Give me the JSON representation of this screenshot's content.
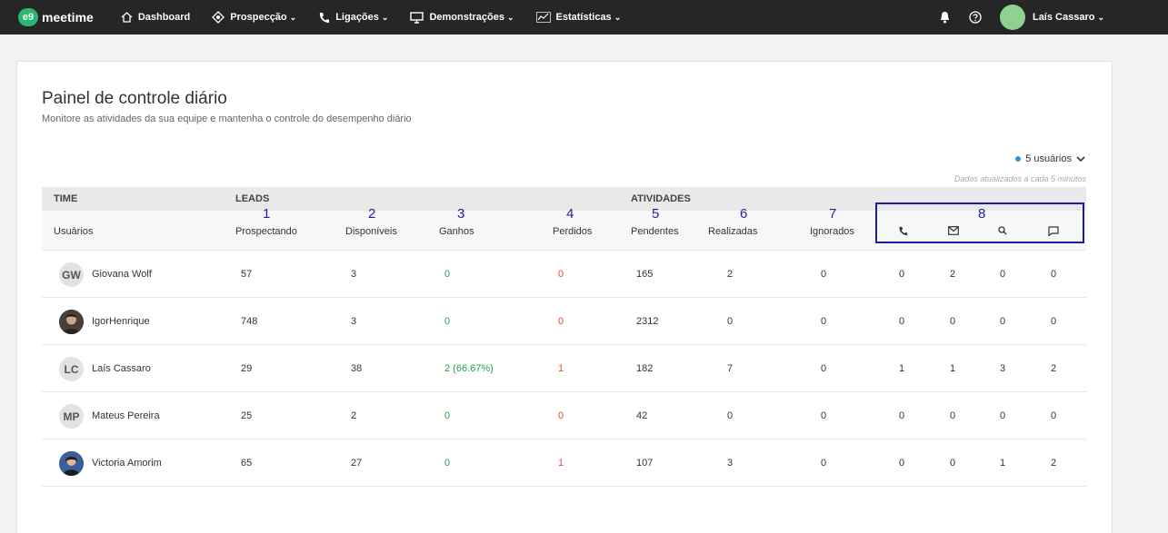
{
  "nav": {
    "logo_badge": "e9",
    "logo_text": "meetime",
    "items": [
      {
        "label": "Dashboard",
        "icon": "home-icon",
        "caret": ""
      },
      {
        "label": "Prospecção",
        "icon": "target-icon",
        "caret": "⌄"
      },
      {
        "label": "Ligações",
        "icon": "phone-icon",
        "caret": "⌄"
      },
      {
        "label": "Demonstrações",
        "icon": "monitor-icon",
        "caret": "⌄"
      },
      {
        "label": "Estatísticas",
        "icon": "chart-icon",
        "caret": "⌄"
      }
    ],
    "user": "Laís Cassaro"
  },
  "page": {
    "title": "Painel de controle diário",
    "subtitle": "Monitore as atividades da sua equipe e mantenha o controle do desempenho diário",
    "users_filter": "5 usuários",
    "updated": "Dados atualizados a cada 5 minutos"
  },
  "table": {
    "groups": {
      "time": "TIME",
      "leads": "LEADS",
      "atividades": "ATIVIDADES"
    },
    "headers": {
      "usuarios": "Usuários",
      "prospectando": "Prospectando",
      "disponiveis": "Disponíveis",
      "ganhos": "Ganhos",
      "perdidos": "Perdidos",
      "pendentes": "Pendentes",
      "realizadas": "Realizadas",
      "ignorados": "Ignorados"
    },
    "annotations": [
      "1",
      "2",
      "3",
      "4",
      "5",
      "6",
      "7",
      "8"
    ],
    "rows": [
      {
        "initials": "GW",
        "name": "Giovana Wolf",
        "prospectando": "57",
        "disponiveis": "3",
        "ganhos": "0",
        "perdidos": "0",
        "pendentes": "165",
        "realizadas": "2",
        "ignorados": "0",
        "calls": "0",
        "emails": "2",
        "searches": "0",
        "messages": "0"
      },
      {
        "initials": "",
        "name": "IgorHenrique",
        "prospectando": "748",
        "disponiveis": "3",
        "ganhos": "0",
        "perdidos": "0",
        "pendentes": "2312",
        "realizadas": "0",
        "ignorados": "0",
        "calls": "0",
        "emails": "0",
        "searches": "0",
        "messages": "0"
      },
      {
        "initials": "LC",
        "name": "Laís Cassaro",
        "prospectando": "29",
        "disponiveis": "38",
        "ganhos": "2 (66.67%)",
        "perdidos": "1",
        "pendentes": "182",
        "realizadas": "7",
        "ignorados": "0",
        "calls": "1",
        "emails": "1",
        "searches": "3",
        "messages": "2"
      },
      {
        "initials": "MP",
        "name": "Mateus Pereira",
        "prospectando": "25",
        "disponiveis": "2",
        "ganhos": "0",
        "perdidos": "0",
        "pendentes": "42",
        "realizadas": "0",
        "ignorados": "0",
        "calls": "0",
        "emails": "0",
        "searches": "0",
        "messages": "0"
      },
      {
        "initials": "",
        "name": "Victoria Amorim",
        "prospectando": "65",
        "disponiveis": "27",
        "ganhos": "0",
        "perdidos": "1",
        "pendentes": "107",
        "realizadas": "3",
        "ignorados": "0",
        "calls": "0",
        "emails": "0",
        "searches": "1",
        "messages": "2"
      }
    ]
  },
  "colors": {
    "nav_bg": "#262626",
    "brand": "#2ab673",
    "positive": "#24a148",
    "negative": "#e5483a",
    "annotation": "#1c1c9e"
  }
}
